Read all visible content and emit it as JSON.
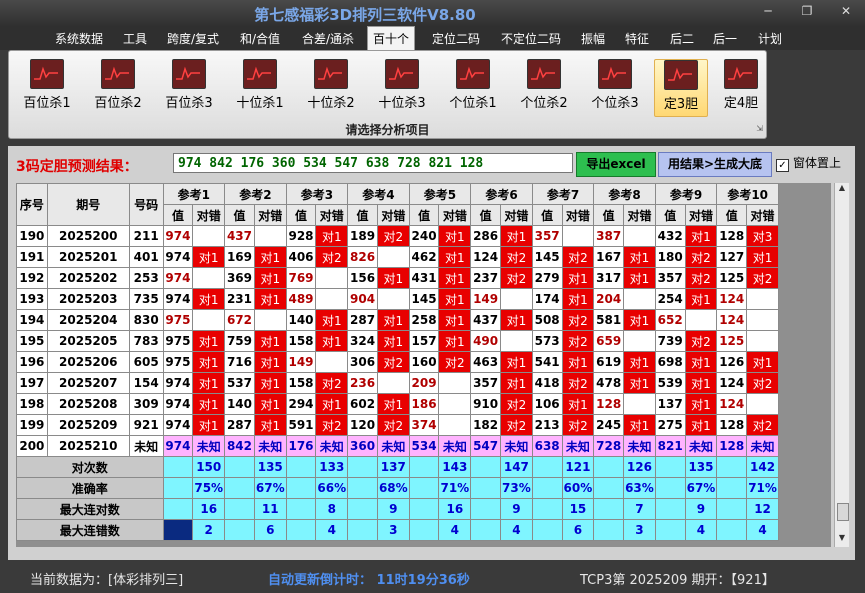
{
  "window": {
    "title": "第七感福彩3D排列三软件V8.80",
    "controls": [
      "minimize-icon",
      "restore-icon",
      "close-icon"
    ]
  },
  "menu": [
    {
      "label": "系统数据",
      "active": false
    },
    {
      "label": "工具",
      "active": false
    },
    {
      "label": "跨度/复式",
      "active": false
    },
    {
      "label": "和/合值",
      "active": false
    },
    {
      "label": "合差/通杀",
      "active": false
    },
    {
      "label": "百十个",
      "active": true
    },
    {
      "label": "定位二码",
      "active": false
    },
    {
      "label": "不定位二码",
      "active": false
    },
    {
      "label": "振幅",
      "active": false
    },
    {
      "label": "特征",
      "active": false
    },
    {
      "label": "后二",
      "active": false
    },
    {
      "label": "后一",
      "active": false
    },
    {
      "label": "计划",
      "active": false
    }
  ],
  "ribbon": {
    "caption": "请选择分析项目",
    "buttons": [
      {
        "label": "百位杀1",
        "icon": "chart-icon",
        "selected": false
      },
      {
        "label": "百位杀2",
        "icon": "chart-icon",
        "selected": false
      },
      {
        "label": "百位杀3",
        "icon": "chart-icon",
        "selected": false
      },
      {
        "label": "十位杀1",
        "icon": "chart-icon",
        "selected": false
      },
      {
        "label": "十位杀2",
        "icon": "chart-icon",
        "selected": false
      },
      {
        "label": "十位杀3",
        "icon": "chart-icon",
        "selected": false
      },
      {
        "label": "个位杀1",
        "icon": "chart-icon",
        "selected": false
      },
      {
        "label": "个位杀2",
        "icon": "chart-icon",
        "selected": false
      },
      {
        "label": "个位杀3",
        "icon": "chart-icon",
        "selected": false
      },
      {
        "label": "定3胆",
        "icon": "chart-icon",
        "selected": true
      },
      {
        "label": "定4胆",
        "icon": "chart-icon",
        "selected": false
      }
    ]
  },
  "result": {
    "label": "3码定胆预测结果：",
    "value": "974 842 176 360 534 547 638 728 821 128",
    "excel_button": "导出excel",
    "generate_button": "用结果>生成大底",
    "topmost_label": "窗体置上",
    "topmost_checked": true
  },
  "table": {
    "headers": {
      "seq": "序号",
      "period": "期号",
      "number": "号码",
      "val": "值",
      "hit": "对错"
    },
    "refs": [
      "参考1",
      "参考2",
      "参考3",
      "参考4",
      "参考5",
      "参考6",
      "参考7",
      "参考8",
      "参考9",
      "参考10"
    ],
    "rows": [
      {
        "seq": "190",
        "period": "2025200",
        "num": "211",
        "cells": [
          [
            "974",
            ""
          ],
          [
            "437",
            ""
          ],
          [
            "928",
            "对1"
          ],
          [
            "189",
            "对2"
          ],
          [
            "240",
            "对1"
          ],
          [
            "286",
            "对1"
          ],
          [
            "357",
            ""
          ],
          [
            "387",
            ""
          ],
          [
            "432",
            "对1"
          ],
          [
            "128",
            "对3"
          ]
        ]
      },
      {
        "seq": "191",
        "period": "2025201",
        "num": "401",
        "cells": [
          [
            "974",
            "对1"
          ],
          [
            "169",
            "对1"
          ],
          [
            "406",
            "对2"
          ],
          [
            "826",
            ""
          ],
          [
            "462",
            "对1"
          ],
          [
            "124",
            "对2"
          ],
          [
            "145",
            "对2"
          ],
          [
            "167",
            "对1"
          ],
          [
            "180",
            "对2"
          ],
          [
            "127",
            "对1"
          ]
        ]
      },
      {
        "seq": "192",
        "period": "2025202",
        "num": "253",
        "cells": [
          [
            "974",
            ""
          ],
          [
            "369",
            "对1"
          ],
          [
            "769",
            ""
          ],
          [
            "156",
            "对1"
          ],
          [
            "431",
            "对1"
          ],
          [
            "237",
            "对2"
          ],
          [
            "279",
            "对1"
          ],
          [
            "317",
            "对1"
          ],
          [
            "357",
            "对2"
          ],
          [
            "125",
            "对2"
          ]
        ]
      },
      {
        "seq": "193",
        "period": "2025203",
        "num": "735",
        "cells": [
          [
            "974",
            "对1"
          ],
          [
            "231",
            "对1"
          ],
          [
            "489",
            ""
          ],
          [
            "904",
            ""
          ],
          [
            "145",
            "对1"
          ],
          [
            "149",
            ""
          ],
          [
            "174",
            "对1"
          ],
          [
            "204",
            ""
          ],
          [
            "254",
            "对1"
          ],
          [
            "124",
            ""
          ]
        ]
      },
      {
        "seq": "194",
        "period": "2025204",
        "num": "830",
        "cells": [
          [
            "975",
            ""
          ],
          [
            "672",
            ""
          ],
          [
            "140",
            "对1"
          ],
          [
            "287",
            "对1"
          ],
          [
            "258",
            "对1"
          ],
          [
            "437",
            "对1"
          ],
          [
            "508",
            "对2"
          ],
          [
            "581",
            "对1"
          ],
          [
            "652",
            ""
          ],
          [
            "124",
            ""
          ]
        ]
      },
      {
        "seq": "195",
        "period": "2025205",
        "num": "783",
        "cells": [
          [
            "975",
            "对1"
          ],
          [
            "759",
            "对1"
          ],
          [
            "158",
            "对1"
          ],
          [
            "324",
            "对1"
          ],
          [
            "157",
            "对1"
          ],
          [
            "490",
            ""
          ],
          [
            "573",
            "对2"
          ],
          [
            "659",
            ""
          ],
          [
            "739",
            "对2"
          ],
          [
            "125",
            ""
          ]
        ]
      },
      {
        "seq": "196",
        "period": "2025206",
        "num": "605",
        "cells": [
          [
            "975",
            "对1"
          ],
          [
            "716",
            "对1"
          ],
          [
            "149",
            ""
          ],
          [
            "306",
            "对2"
          ],
          [
            "160",
            "对2"
          ],
          [
            "463",
            "对1"
          ],
          [
            "541",
            "对1"
          ],
          [
            "619",
            "对1"
          ],
          [
            "698",
            "对1"
          ],
          [
            "126",
            "对1"
          ]
        ]
      },
      {
        "seq": "197",
        "period": "2025207",
        "num": "154",
        "cells": [
          [
            "974",
            "对1"
          ],
          [
            "537",
            "对1"
          ],
          [
            "158",
            "对2"
          ],
          [
            "236",
            ""
          ],
          [
            "209",
            ""
          ],
          [
            "357",
            "对1"
          ],
          [
            "418",
            "对2"
          ],
          [
            "478",
            "对1"
          ],
          [
            "539",
            "对1"
          ],
          [
            "124",
            "对2"
          ]
        ]
      },
      {
        "seq": "198",
        "period": "2025208",
        "num": "309",
        "cells": [
          [
            "974",
            "对1"
          ],
          [
            "140",
            "对1"
          ],
          [
            "294",
            "对1"
          ],
          [
            "602",
            "对1"
          ],
          [
            "186",
            ""
          ],
          [
            "910",
            "对2"
          ],
          [
            "106",
            "对1"
          ],
          [
            "128",
            ""
          ],
          [
            "137",
            "对1"
          ],
          [
            "124",
            ""
          ]
        ]
      },
      {
        "seq": "199",
        "period": "2025209",
        "num": "921",
        "cells": [
          [
            "974",
            "对1"
          ],
          [
            "287",
            "对1"
          ],
          [
            "591",
            "对2"
          ],
          [
            "120",
            "对2"
          ],
          [
            "374",
            ""
          ],
          [
            "182",
            "对2"
          ],
          [
            "213",
            "对2"
          ],
          [
            "245",
            "对1"
          ],
          [
            "275",
            "对1"
          ],
          [
            "128",
            "对2"
          ]
        ]
      }
    ],
    "pred_row": {
      "seq": "200",
      "period": "2025210",
      "num": "未知",
      "unknown": "未知",
      "values": [
        "974",
        "842",
        "176",
        "360",
        "534",
        "547",
        "638",
        "728",
        "821",
        "128"
      ]
    },
    "stats": [
      {
        "label": "对次数",
        "values": [
          "150",
          "135",
          "133",
          "137",
          "143",
          "147",
          "121",
          "126",
          "135",
          "142"
        ]
      },
      {
        "label": "准确率",
        "values": [
          "75%",
          "67%",
          "66%",
          "68%",
          "71%",
          "73%",
          "60%",
          "63%",
          "67%",
          "71%"
        ]
      },
      {
        "label": "最大连对数",
        "values": [
          "16",
          "11",
          "8",
          "9",
          "16",
          "9",
          "15",
          "7",
          "9",
          "12"
        ]
      },
      {
        "label": "最大连错数",
        "values": [
          "2",
          "6",
          "4",
          "3",
          "4",
          "4",
          "6",
          "3",
          "4",
          "4"
        ]
      }
    ]
  },
  "status": {
    "current_data": "当前数据为：[体彩排列三]",
    "countdown": "自动更新倒计时：  11时19分36秒",
    "issue": "TCP3第 2025209 期开：【921】"
  }
}
